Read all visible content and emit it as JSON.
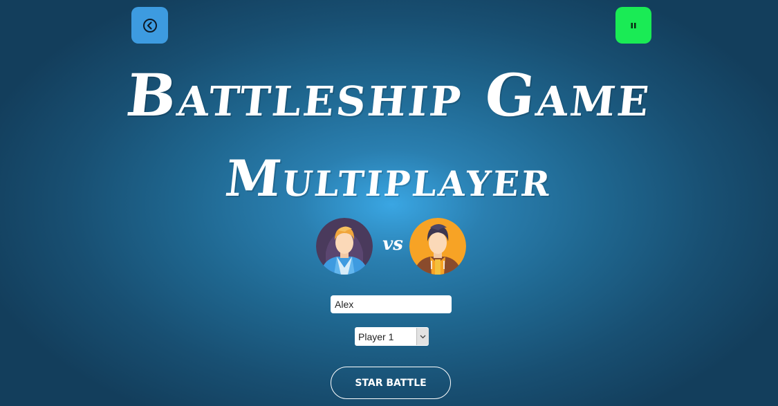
{
  "header": {
    "back_icon": "chevron-left-circle-icon",
    "pause_icon": "pause-icon",
    "colors": {
      "back": "#3d9be0",
      "pause": "#1aeb55"
    }
  },
  "title": {
    "main": "Battleship Game",
    "sub": "Multiplayer"
  },
  "players": {
    "player1_avatar": "blonde-man-avatar",
    "player2_avatar": "dark-hair-man-avatar",
    "vs_label": "vs"
  },
  "form": {
    "name_value": "Alex",
    "player_select": {
      "selected": "Player 1"
    },
    "start_label": "STAR BATTLE"
  }
}
